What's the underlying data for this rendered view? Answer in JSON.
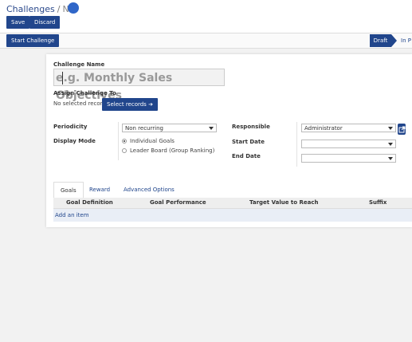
{
  "breadcrumb": {
    "root": "Challenges",
    "separator": "/",
    "current": "N"
  },
  "buttons": {
    "save": "Save",
    "discard": "Discard",
    "start_challenge": "Start Challenge",
    "select_records": "Select records"
  },
  "status": {
    "active": "Draft",
    "next": "In P"
  },
  "form": {
    "challenge_name_label": "Challenge Name",
    "challenge_name_placeholder": "e.g. Monthly Sales Objectives",
    "assign_label": "Assign Challenge To",
    "no_selection": "No selected record",
    "periodicity_label": "Periodicity",
    "periodicity_value": "Non recurring",
    "display_mode_label": "Display Mode",
    "display_modes": [
      "Individual Goals",
      "Leader Board (Group Ranking)"
    ],
    "display_mode_selected": 0,
    "responsible_label": "Responsible",
    "responsible_value": "Administrator",
    "start_date_label": "Start Date",
    "start_date_value": "",
    "end_date_label": "End Date",
    "end_date_value": ""
  },
  "tabs": [
    "Goals",
    "Reward",
    "Advanced Options"
  ],
  "active_tab": 0,
  "goals_table": {
    "columns": [
      "Goal Definition",
      "Goal Performance",
      "Target Value to Reach",
      "Suffix"
    ],
    "add_item": "Add an item"
  },
  "colors": {
    "primary": "#21468c",
    "accent": "#2f66c8"
  },
  "icons": {
    "external_link": "external-link-icon",
    "arrow_right": "arrow-right-icon"
  }
}
